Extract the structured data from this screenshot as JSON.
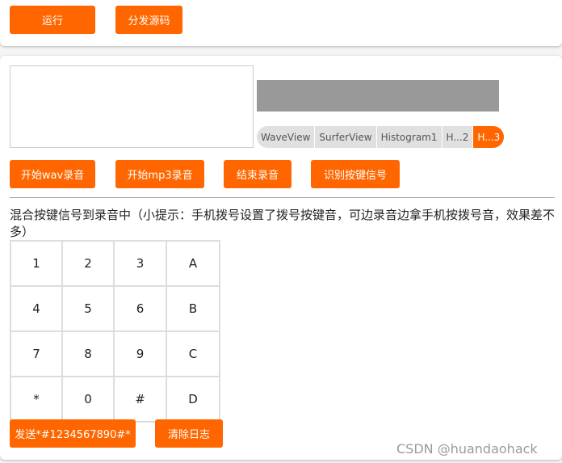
{
  "toolbar": {
    "run_label": "运行",
    "share_label": "分发源码"
  },
  "visual": {
    "tabs": [
      {
        "label": "WaveView"
      },
      {
        "label": "SurferView"
      },
      {
        "label": "Histogram1"
      },
      {
        "label": "H...2"
      },
      {
        "label": "H...3"
      }
    ],
    "active_tab": "H...3"
  },
  "record_buttons": {
    "wav": "开始wav录音",
    "mp3": "开始mp3录音",
    "stop": "结束录音",
    "detect": "识别按键信号"
  },
  "hint": "混合按键信号到录音中（小提示：手机拨号设置了拨号按键音，可边录音边拿手机按拨号音，效果差不多）",
  "keypad": {
    "keys": [
      "1",
      "2",
      "3",
      "A",
      "4",
      "5",
      "6",
      "B",
      "7",
      "8",
      "9",
      "C",
      "*",
      "0",
      "#",
      "D"
    ]
  },
  "actions": {
    "send": "发送*#1234567890#*",
    "clear_log": "清除日志"
  },
  "watermark": "CSDN @huandaohack",
  "colors": {
    "accent": "#ff6600"
  }
}
